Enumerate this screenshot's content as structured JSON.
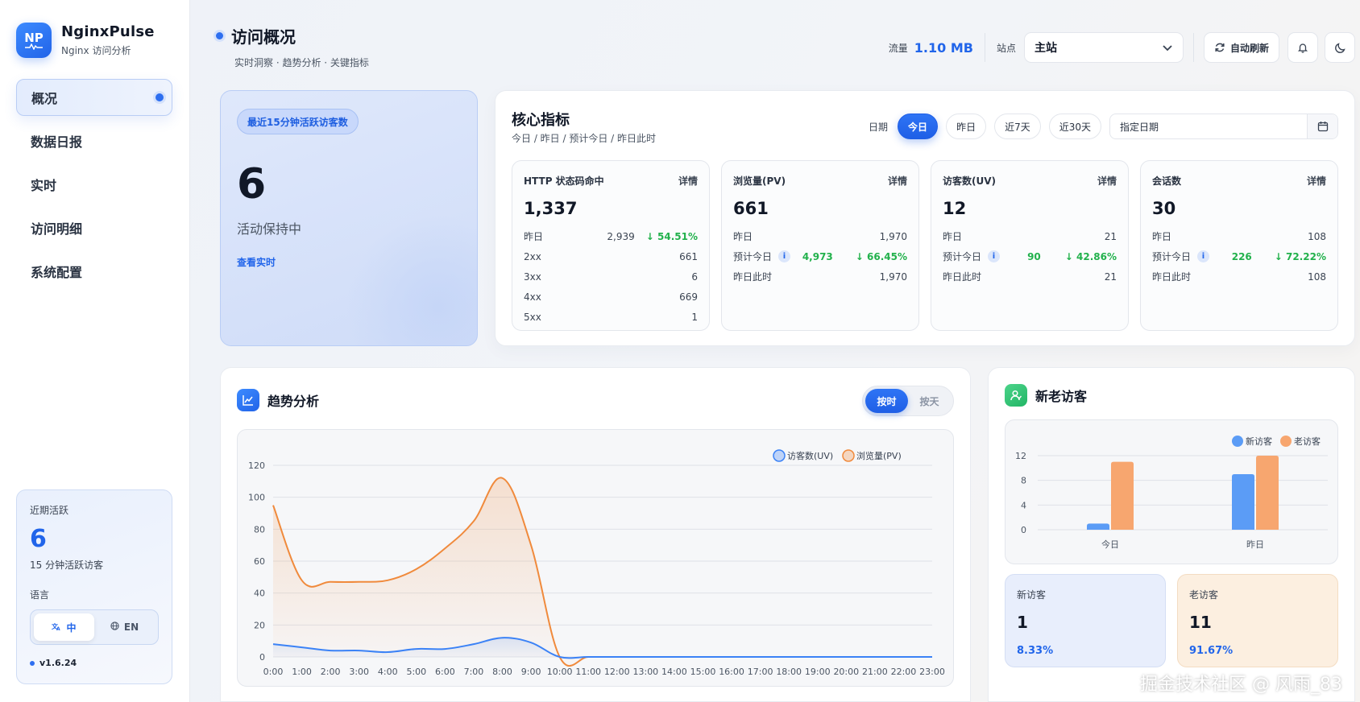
{
  "brand": {
    "logo": "NP",
    "name": "NginxPulse",
    "subtitle": "Nginx 访问分析"
  },
  "nav": [
    {
      "label": "概况",
      "active": true
    },
    {
      "label": "数据日报"
    },
    {
      "label": "实时"
    },
    {
      "label": "访问明细"
    },
    {
      "label": "系统配置"
    }
  ],
  "side_card": {
    "title": "近期活跃",
    "value": "6",
    "sub": "15 分钟活跃访客",
    "lang_label": "语言",
    "lang_zh": "中",
    "lang_en": "EN",
    "version": "v1.6.24"
  },
  "header": {
    "title": "访问概况",
    "subtitle": "实时洞察 · 趋势分析 · 关键指标",
    "traffic_label": "流量",
    "traffic_value": "1.10 MB",
    "site_label": "站点",
    "site_value": "主站",
    "auto_refresh": "自动刷新"
  },
  "active_card": {
    "pill": "最近15分钟活跃访客数",
    "value": "6",
    "status": "活动保持中",
    "link": "查看实时"
  },
  "core": {
    "title": "核心指标",
    "subtitle": "今日 / 昨日 / 预计今日 / 昨日此时",
    "date_label": "日期",
    "buttons": [
      "今日",
      "昨日",
      "近7天",
      "近30天"
    ],
    "date_placeholder": "指定日期",
    "cards": [
      {
        "title": "HTTP 状态码命中",
        "detail": "详情",
        "value": "1,337",
        "rows": [
          {
            "label": "昨日",
            "value": "2,939",
            "change": "↓ 54.51%"
          },
          {
            "label": "2xx",
            "value": "661"
          },
          {
            "label": "3xx",
            "value": "6"
          },
          {
            "label": "4xx",
            "value": "669"
          },
          {
            "label": "5xx",
            "value": "1"
          }
        ]
      },
      {
        "title": "浏览量(PV)",
        "detail": "详情",
        "value": "661",
        "rows": [
          {
            "label": "昨日",
            "value": "1,970"
          },
          {
            "label": "预计今日",
            "info": true,
            "forecast": "4,973",
            "change": "↓ 66.45%"
          },
          {
            "label": "昨日此时",
            "value": "1,970"
          }
        ]
      },
      {
        "title": "访客数(UV)",
        "detail": "详情",
        "value": "12",
        "rows": [
          {
            "label": "昨日",
            "value": "21"
          },
          {
            "label": "预计今日",
            "info": true,
            "forecast": "90",
            "change": "↓ 42.86%"
          },
          {
            "label": "昨日此时",
            "value": "21"
          }
        ]
      },
      {
        "title": "会话数",
        "detail": "详情",
        "value": "30",
        "rows": [
          {
            "label": "昨日",
            "value": "108"
          },
          {
            "label": "预计今日",
            "info": true,
            "forecast": "226",
            "change": "↓ 72.22%"
          },
          {
            "label": "昨日此时",
            "value": "108"
          }
        ]
      }
    ]
  },
  "trend": {
    "title": "趋势分析",
    "seg_hour": "按时",
    "seg_day": "按天"
  },
  "visitors": {
    "title": "新老访客",
    "new_label": "新访客",
    "new_value": "1",
    "new_pct": "8.33%",
    "old_label": "老访客",
    "old_value": "11",
    "old_pct": "91.67%"
  },
  "watermark": "掘金技术社区 @ 风雨_83",
  "colors": {
    "accent": "#2165ea",
    "uv": "#3b82f6",
    "pv": "#f08a3c",
    "new": "#5b9cf6",
    "old": "#f7a66f",
    "up_down": "#22b14c"
  },
  "chart_data": [
    {
      "type": "line",
      "x": [
        "0:00",
        "1:00",
        "2:00",
        "3:00",
        "4:00",
        "5:00",
        "6:00",
        "7:00",
        "8:00",
        "9:00",
        "10:00",
        "11:00",
        "12:00",
        "13:00",
        "14:00",
        "15:00",
        "16:00",
        "17:00",
        "18:00",
        "19:00",
        "20:00",
        "21:00",
        "22:00",
        "23:00"
      ],
      "series": [
        {
          "name": "访客数(UV)",
          "values": [
            8,
            6,
            4,
            4,
            3,
            5,
            5,
            8,
            12,
            9,
            0,
            0,
            0,
            0,
            0,
            0,
            0,
            0,
            0,
            0,
            0,
            0,
            0,
            0
          ]
        },
        {
          "name": "浏览量(PV)",
          "values": [
            95,
            48,
            47,
            47,
            48,
            55,
            68,
            85,
            112,
            70,
            0,
            0,
            0,
            0,
            0,
            0,
            0,
            0,
            0,
            0,
            0,
            0,
            0,
            0
          ]
        }
      ],
      "ylim": [
        0,
        120
      ],
      "yticks": [
        0,
        20,
        40,
        60,
        80,
        100,
        120
      ],
      "grid": true,
      "legend": "top-right"
    },
    {
      "type": "bar",
      "categories": [
        "今日",
        "昨日"
      ],
      "series": [
        {
          "name": "新访客",
          "values": [
            1,
            9
          ]
        },
        {
          "name": "老访客",
          "values": [
            11,
            12
          ]
        }
      ],
      "ylim": [
        0,
        12
      ],
      "yticks": [
        0,
        4,
        8,
        12
      ],
      "grid": true,
      "legend": "top-right"
    }
  ]
}
